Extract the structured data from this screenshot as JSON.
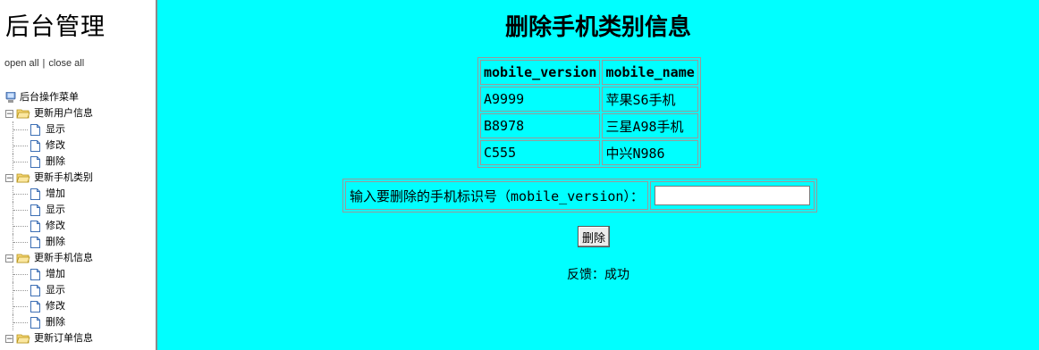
{
  "sidebar": {
    "title": "后台管理",
    "open_all": "open all",
    "separator": "|",
    "close_all": "close all",
    "root_label": "后台操作菜单",
    "groups": [
      {
        "label": "更新用户信息",
        "items": [
          "显示",
          "修改",
          "删除"
        ]
      },
      {
        "label": "更新手机类别",
        "items": [
          "增加",
          "显示",
          "修改",
          "删除"
        ]
      },
      {
        "label": "更新手机信息",
        "items": [
          "增加",
          "显示",
          "修改",
          "删除"
        ]
      },
      {
        "label": "更新订单信息",
        "items": []
      }
    ]
  },
  "main": {
    "title": "删除手机类别信息",
    "table": {
      "headers": [
        "mobile_version",
        "mobile_name"
      ],
      "rows": [
        [
          "A9999",
          "苹果S6手机"
        ],
        [
          "B8978",
          "三星A98手机"
        ],
        [
          "C555",
          "中兴N986"
        ]
      ]
    },
    "form": {
      "label": "输入要删除的手机标识号（mobile_version）：",
      "input_value": ""
    },
    "delete_button": "删除",
    "feedback": "反馈：成功"
  },
  "colors": {
    "main_background": "#00ffff",
    "sidebar_background": "#ffffff"
  },
  "icons": {
    "root": "computer-icon",
    "group": "folder-open-icon",
    "leaf": "document-icon"
  }
}
